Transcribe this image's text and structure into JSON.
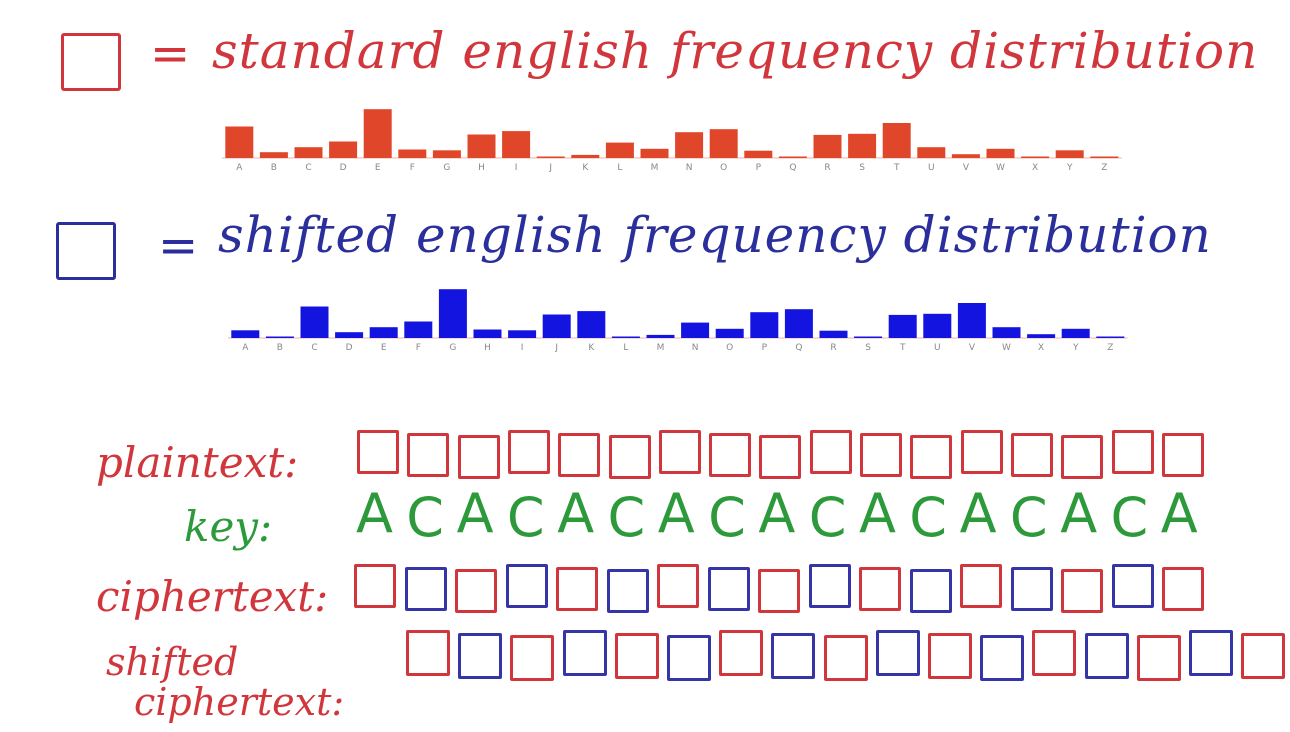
{
  "legend": {
    "standard": {
      "label": "standard english frequency distribution",
      "color": "#d0363b"
    },
    "shifted": {
      "label": "shifted english frequency distribution",
      "color": "#2a2f9c"
    },
    "equals": "="
  },
  "chart_data": [
    {
      "type": "bar",
      "name": "standard english frequency distribution",
      "color": "#e0462a",
      "categories": [
        "A",
        "B",
        "C",
        "D",
        "E",
        "F",
        "G",
        "H",
        "I",
        "J",
        "K",
        "L",
        "M",
        "N",
        "O",
        "P",
        "Q",
        "R",
        "S",
        "T",
        "U",
        "V",
        "W",
        "X",
        "Y",
        "Z"
      ],
      "values": [
        8.2,
        1.5,
        2.8,
        4.3,
        12.7,
        2.2,
        2.0,
        6.1,
        7.0,
        0.2,
        0.8,
        4.0,
        2.4,
        6.7,
        7.5,
        1.9,
        0.1,
        6.0,
        6.3,
        9.1,
        2.8,
        1.0,
        2.4,
        0.2,
        2.0,
        0.1
      ],
      "ylim": [
        0,
        13
      ],
      "grid": false
    },
    {
      "type": "bar",
      "name": "shifted english frequency distribution",
      "color": "#1414e0",
      "categories": [
        "A",
        "B",
        "C",
        "D",
        "E",
        "F",
        "G",
        "H",
        "I",
        "J",
        "K",
        "L",
        "M",
        "N",
        "O",
        "P",
        "Q",
        "R",
        "S",
        "T",
        "U",
        "V",
        "W",
        "X",
        "Y",
        "Z"
      ],
      "values": [
        2.0,
        0.1,
        8.2,
        1.5,
        2.8,
        4.3,
        12.7,
        2.2,
        2.0,
        6.1,
        7.0,
        0.2,
        0.8,
        4.0,
        2.4,
        6.7,
        7.5,
        1.9,
        0.1,
        6.0,
        6.3,
        9.1,
        2.8,
        1.0,
        2.4,
        0.2
      ],
      "ylim": [
        0,
        13
      ],
      "grid": false
    }
  ],
  "rows": {
    "plaintext": {
      "label": "plaintext:",
      "pattern": "rrrrrrrrrrrrrrrrr"
    },
    "key": {
      "label": "key:",
      "chars": [
        "A",
        "C",
        "A",
        "C",
        "A",
        "C",
        "A",
        "C",
        "A",
        "C",
        "A",
        "C",
        "A",
        "C",
        "A",
        "C",
        "A"
      ]
    },
    "ciphertext": {
      "label": "ciphertext:",
      "pattern": "rbrbrbrbrbrbrbrbr"
    },
    "shifted_ciphertext": {
      "label_line1": "shifted",
      "label_line2": "ciphertext:",
      "pattern": "rbrbrbrbrbrbrbrbr"
    }
  }
}
